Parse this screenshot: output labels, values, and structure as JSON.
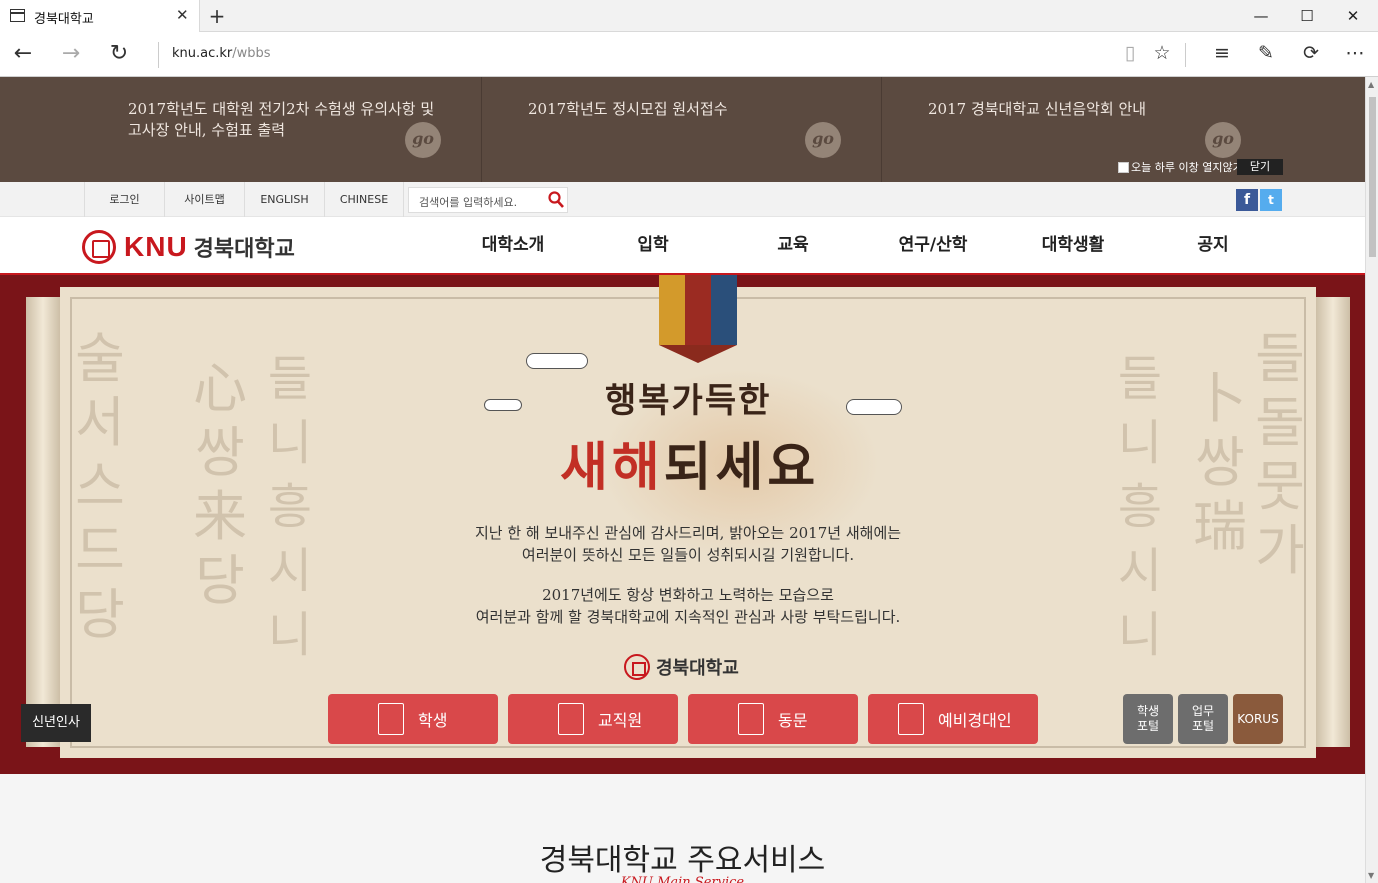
{
  "browser": {
    "tab_title": "경북대학교",
    "url_host": "knu.ac.kr",
    "url_path": "/wbbs"
  },
  "notices": [
    {
      "text": "2017학년도 대학원 전기2차 수험생 유의사항 및 고사장 안내, 수험표 출력",
      "go": "go"
    },
    {
      "text": "2017학년도 정시모집 원서접수",
      "go": "go"
    },
    {
      "text": "2017 경북대학교 신년음악회 안내",
      "go": "go"
    }
  ],
  "notice_options": {
    "dont_open_today": "오늘 하루 이창 열지않기",
    "close": "닫기"
  },
  "util": {
    "links": [
      "로그인",
      "사이트맵",
      "ENGLISH",
      "CHINESE"
    ],
    "search_placeholder": "검색어를 입력하세요."
  },
  "header": {
    "logo_en": "KNU",
    "logo_kr": "경북대학교",
    "menu": [
      "대학소개",
      "입학",
      "교육",
      "연구/산학",
      "대학생활",
      "공지"
    ]
  },
  "hero": {
    "calligraphy_1": "행복가득한",
    "calligraphy_2a": "새해",
    "calligraphy_2b": "되세요",
    "message_1a": "지난 한 해 보내주신 관심에 감사드리며, 밝아오는 2017년 새해에는",
    "message_1b": "여러분이 뜻하신 모든 일들이 성취되시길 기원합니다.",
    "message_2a": "2017년에도 항상 변화하고 노력하는 모습으로",
    "message_2b": "여러분과 함께 할 경북대학교에 지속적인 관심과 사랑 부탁드립니다.",
    "sign": "경북대학교",
    "greeting_tab": "신년인사",
    "quick_buttons": [
      "학생",
      "교직원",
      "동문",
      "예비경대인"
    ],
    "portals": [
      {
        "line1": "학생",
        "line2": "포털",
        "color": "#6d6d6d"
      },
      {
        "line1": "업무",
        "line2": "포털",
        "color": "#6d6d6d"
      },
      {
        "line1": "KORUS",
        "line2": "",
        "color": "#8a5a3c"
      }
    ]
  },
  "services": {
    "title": "경북대학교 주요서비스",
    "subtitle": "KNU Main Service"
  },
  "colors": {
    "brand_red": "#c8181e",
    "notice_bg": "#5b4a40",
    "quick_btn": "#d9484a"
  }
}
